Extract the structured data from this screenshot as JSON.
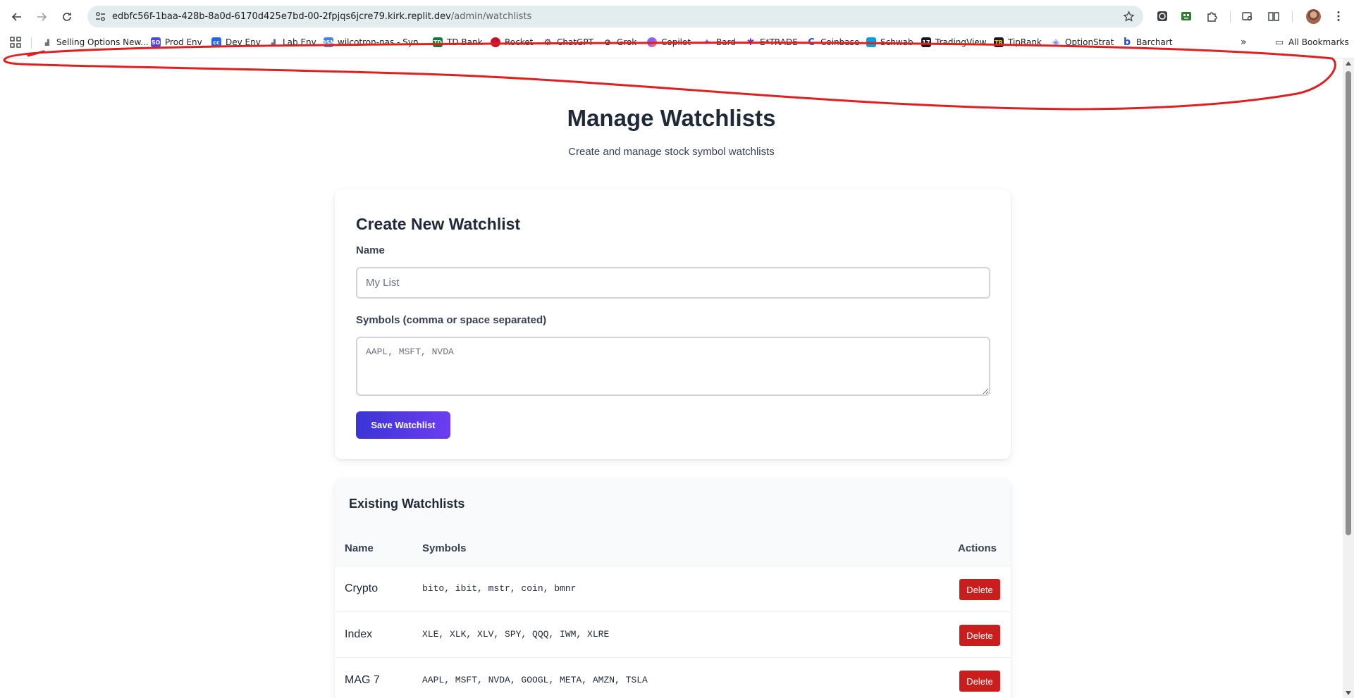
{
  "browser": {
    "url_host": "edbfc56f-1baa-428b-8a0d-6170d425e7bd-00-2fpjqs6jcre79.kirk.replit.dev",
    "url_path": "/admin/watchlists",
    "bookmarks": [
      {
        "label": "Selling Options New...",
        "icon": "chart-icon",
        "color": "#6b7280"
      },
      {
        "label": "Prod Env",
        "icon": "so-icon",
        "color": "#4f46e5"
      },
      {
        "label": "Dev Env",
        "icon": "cc-icon",
        "color": "#2563eb"
      },
      {
        "label": "Lab Env",
        "icon": "chart-icon",
        "color": "#6b7280"
      },
      {
        "label": "wilcotron-nas - Syn...",
        "icon": "dsm-icon",
        "color": "#3b82f6"
      },
      {
        "label": "TD Bank",
        "icon": "td-icon",
        "color": "#0a7d3b"
      },
      {
        "label": "Rocket",
        "icon": "rocket-icon",
        "color": "#c8102e"
      },
      {
        "label": "ChatGPT",
        "icon": "chatgpt-icon",
        "color": "#202124"
      },
      {
        "label": "Grok",
        "icon": "grok-icon",
        "color": "#202124"
      },
      {
        "label": "Copilot",
        "icon": "copilot-icon",
        "color": "#7c3aed"
      },
      {
        "label": "Bard",
        "icon": "bard-icon",
        "color": "#4285f4"
      },
      {
        "label": "E*TRADE",
        "icon": "etrade-icon",
        "color": "#6633cc"
      },
      {
        "label": "Coinbase",
        "icon": "coinbase-icon",
        "color": "#1652f0"
      },
      {
        "label": "Schwab",
        "icon": "schwab-icon",
        "color": "#00a0df"
      },
      {
        "label": "TradingView",
        "icon": "tradingview-icon",
        "color": "#131722"
      },
      {
        "label": "TipRank",
        "icon": "tipranks-icon",
        "color": "#1a1a1a"
      },
      {
        "label": "OptionStrat",
        "icon": "optionstrat-icon",
        "color": "#7c8cff"
      },
      {
        "label": "Barchart",
        "icon": "barchart-icon",
        "color": "#1e4fd7"
      }
    ],
    "all_bookmarks": "All Bookmarks"
  },
  "page": {
    "title": "Manage Watchlists",
    "subtitle": "Create and manage stock symbol watchlists"
  },
  "create": {
    "heading": "Create New Watchlist",
    "name_label": "Name",
    "name_placeholder": "My List",
    "symbols_label": "Symbols (comma or space separated)",
    "symbols_placeholder": "AAPL, MSFT, NVDA",
    "save_label": "Save Watchlist"
  },
  "existing": {
    "heading": "Existing Watchlists",
    "columns": {
      "name": "Name",
      "symbols": "Symbols",
      "actions": "Actions"
    },
    "rows": [
      {
        "name": "Crypto",
        "symbols": "bito, ibit, mstr, coin, bmnr",
        "action": "Delete"
      },
      {
        "name": "Index",
        "symbols": "XLE, XLK, XLV, SPY, QQQ, IWM, XLRE",
        "action": "Delete"
      },
      {
        "name": "MAG 7",
        "symbols": "AAPL, MSFT, NVDA, GOOGL, META, AMZN, TSLA",
        "action": "Delete"
      }
    ]
  },
  "colors": {
    "accent_start": "#3b34d6",
    "accent_end": "#6d3df2",
    "danger": "#c81e1e",
    "annotation": "#e02020"
  }
}
